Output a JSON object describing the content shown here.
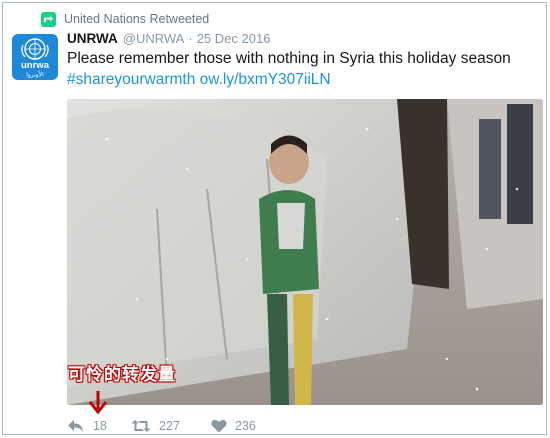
{
  "retweet_context": {
    "text": "United Nations Retweeted",
    "icon": "retweet-icon",
    "color": "#19cf86"
  },
  "avatar": {
    "logo_text": "unrwa",
    "logo_arabic": "الأونروا",
    "icon": "un-emblem-icon",
    "color": "#1e88d9"
  },
  "tweet": {
    "name": "UNRWA",
    "handle": "@UNRWA",
    "separator": "·",
    "date": "25 Dec 2016",
    "text_line1": "Please remember those with nothing in Syria this holiday season",
    "hashtag": "#shareyourwarmth",
    "link": "ow.ly/bxmY307iiLN",
    "link_color": "#1b95e0"
  },
  "annotation": {
    "text": "可怜的转发量",
    "color": "#c00000"
  },
  "actions": {
    "reply": {
      "icon": "reply-icon",
      "count": "18"
    },
    "retweet": {
      "icon": "retweet-icon",
      "count": "227"
    },
    "like": {
      "icon": "heart-icon",
      "count": "236"
    }
  }
}
